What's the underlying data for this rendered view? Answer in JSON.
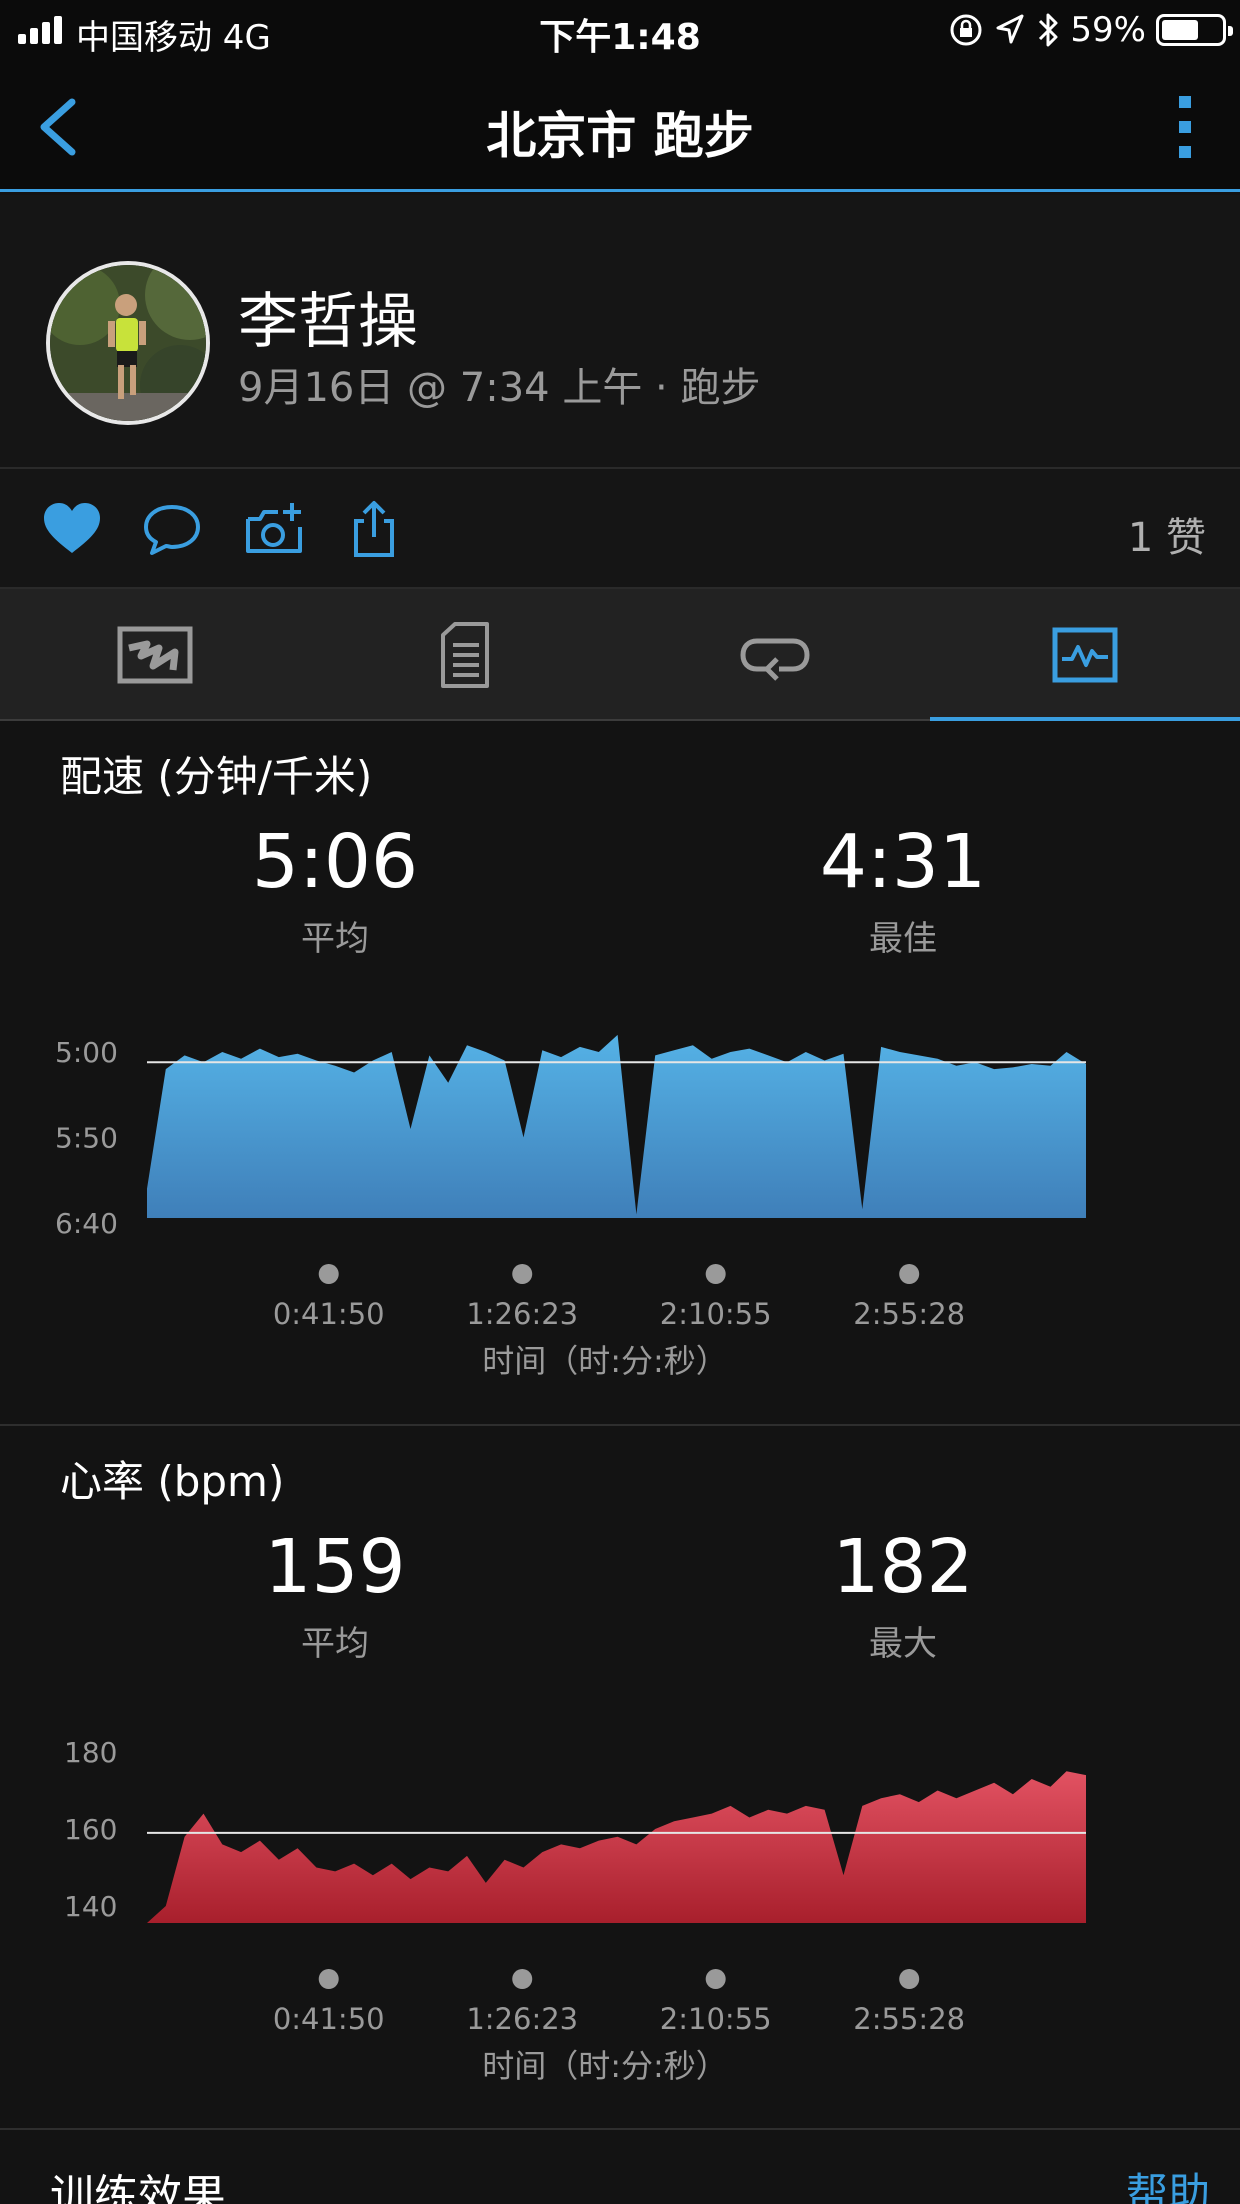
{
  "status_bar": {
    "carrier": "中国移动   4G",
    "time": "下午1:48",
    "battery": "59%"
  },
  "nav": {
    "title": "北京市 跑步",
    "back_icon": "chevron-left-icon",
    "more_icon": "more-vertical-icon"
  },
  "profile": {
    "name": "李哲操",
    "meta": "9月16日 @ 7:34 上午 · 跑步"
  },
  "actions": {
    "icons": [
      "heart-icon",
      "comment-icon",
      "camera-add-icon",
      "share-icon"
    ],
    "likes": "1 赞"
  },
  "tabs": [
    {
      "icon": "map-icon",
      "active": false
    },
    {
      "icon": "stats-list-icon",
      "active": false
    },
    {
      "icon": "laps-icon",
      "active": false
    },
    {
      "icon": "charts-icon",
      "active": true
    }
  ],
  "pace_section": {
    "title": "配速 (分钟/千米)",
    "avg_value": "5:06",
    "avg_label": "平均",
    "best_value": "4:31",
    "best_label": "最佳"
  },
  "hr_section": {
    "title": "心率 (bpm)",
    "avg_value": "159",
    "avg_label": "平均",
    "max_value": "182",
    "max_label": "最大"
  },
  "chart_data": [
    {
      "type": "area",
      "color": "#4aa3dc",
      "y_tick_labels": [
        "5:00",
        "5:50",
        "6:40"
      ],
      "y_tick_values_sec": [
        300,
        350,
        400
      ],
      "y_inverted": true,
      "average_line_sec": 306,
      "x_tick_labels": [
        "0:41:50",
        "1:26:23",
        "2:10:55",
        "2:55:28"
      ],
      "x_tick_values_sec": [
        2510,
        5183,
        7855,
        10528
      ],
      "x_range_sec": [
        0,
        12970
      ],
      "xlabel": "时间（时:分:秒）",
      "series": [
        {
          "x": [
            0,
            260,
            520,
            780,
            1040,
            1300,
            1560,
            1820,
            2080,
            2340,
            2600,
            2860,
            3120,
            3380,
            3640,
            3900,
            4160,
            4420,
            4680,
            4940,
            5200,
            5460,
            5720,
            5980,
            6240,
            6500,
            6760,
            7020,
            7280,
            7540,
            7800,
            8060,
            8320,
            8580,
            8840,
            9100,
            9360,
            9620,
            9880,
            10140,
            10400,
            10660,
            10920,
            11180,
            11440,
            11700,
            11960,
            12220,
            12480,
            12700,
            12970
          ],
          "values": [
            380,
            310,
            302,
            306,
            300,
            304,
            298,
            303,
            301,
            305,
            308,
            312,
            305,
            300,
            345,
            302,
            318,
            296,
            300,
            305,
            350,
            299,
            303,
            297,
            300,
            290,
            395,
            302,
            299,
            296,
            304,
            300,
            298,
            302,
            306,
            300,
            305,
            301,
            392,
            297,
            300,
            302,
            304,
            308,
            306,
            310,
            309,
            307,
            308,
            300,
            307
          ]
        }
      ]
    },
    {
      "type": "area",
      "color": "#d84252",
      "y_tick_labels": [
        "180",
        "160",
        "140"
      ],
      "y_tick_values": [
        180,
        160,
        140
      ],
      "average_line": 159,
      "x_tick_labels": [
        "0:41:50",
        "1:26:23",
        "2:10:55",
        "2:55:28"
      ],
      "x_tick_values_sec": [
        2510,
        5183,
        7855,
        10528
      ],
      "x_range_sec": [
        0,
        12970
      ],
      "xlabel": "时间（时:分:秒）",
      "series": [
        {
          "x": [
            0,
            260,
            520,
            780,
            1040,
            1300,
            1560,
            1820,
            2080,
            2340,
            2600,
            2860,
            3120,
            3380,
            3640,
            3900,
            4160,
            4420,
            4680,
            4940,
            5200,
            5460,
            5720,
            5980,
            6240,
            6500,
            6760,
            7020,
            7280,
            7540,
            7800,
            8060,
            8320,
            8580,
            8840,
            9100,
            9360,
            9620,
            9880,
            10140,
            10400,
            10660,
            10920,
            11180,
            11440,
            11700,
            11960,
            12220,
            12480,
            12700,
            12970
          ],
          "values": [
            130,
            140,
            158,
            164,
            156,
            154,
            157,
            152,
            155,
            150,
            149,
            151,
            148,
            151,
            147,
            150,
            149,
            153,
            146,
            152,
            150,
            154,
            156,
            155,
            157,
            158,
            156,
            160,
            162,
            163,
            164,
            166,
            163,
            165,
            164,
            166,
            165,
            148,
            166,
            168,
            169,
            167,
            170,
            168,
            170,
            172,
            169,
            173,
            171,
            175,
            174
          ]
        }
      ]
    }
  ],
  "bottom": {
    "title": "训练效果",
    "help": "帮助"
  }
}
